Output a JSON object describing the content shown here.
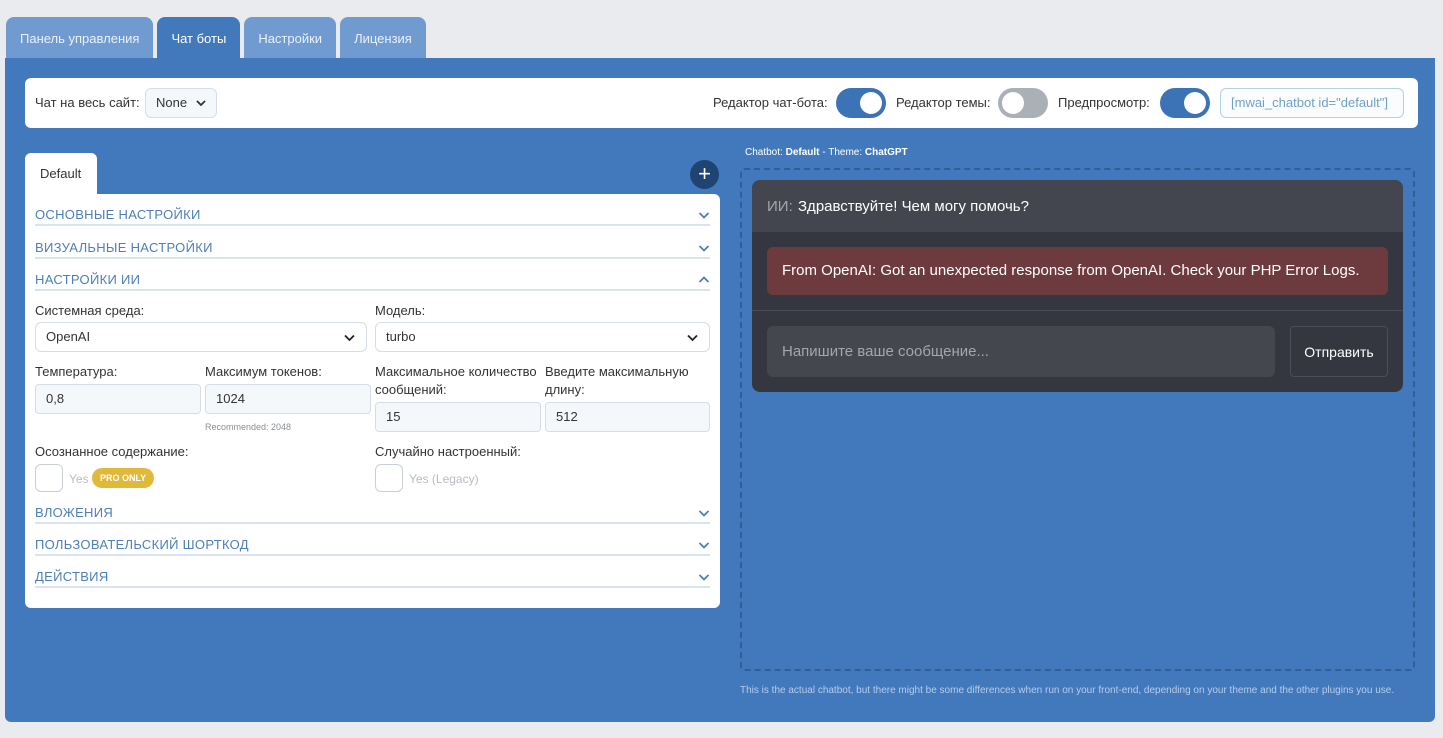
{
  "tabs": [
    "Панель управления",
    "Чат боты",
    "Настройки",
    "Лицензия"
  ],
  "active_tab": "Чат боты",
  "topbar": {
    "sitewide_label": "Чат на весь сайт:",
    "sitewide_value": "None",
    "chatbot_editor_label": "Редактор чат-бота:",
    "chatbot_editor_on": true,
    "theme_editor_label": "Редактор темы:",
    "theme_editor_on": false,
    "preview_label": "Предпросмотр:",
    "preview_on": true,
    "shortcode": "[mwai_chatbot id=\"default\"]"
  },
  "card_tab": "Default",
  "add_symbol": "+",
  "sections": {
    "basic": "ОСНОВНЫЕ НАСТРОЙКИ",
    "visual": "ВИЗУАЛЬНЫЕ НАСТРОЙКИ",
    "ai": "НАСТРОЙКИ ИИ",
    "attachments": "ВЛОЖЕНИЯ",
    "shortcode": "ПОЛЬЗОВАТЕЛЬСКИЙ ШОРТКОД",
    "actions": "ДЕЙСТВИЯ"
  },
  "ai_settings": {
    "env_label": "Системная среда:",
    "env_value": "OpenAI",
    "model_label": "Модель:",
    "model_value": "turbo",
    "temp_label": "Температура:",
    "temp_value": "0,8",
    "max_tokens_label": "Максимум токенов:",
    "max_tokens_value": "1024",
    "max_tokens_hint": "Recommended: 2048",
    "max_messages_label_1": "Максимальное количество",
    "max_messages_label_2": "сообщений:",
    "max_messages_value": "15",
    "max_length_label_1": "Введите максимальную",
    "max_length_label_2": "длину:",
    "max_length_value": "512",
    "content_aware_label": "Осознанное содержание:",
    "content_aware_yes": "Yes",
    "pro_badge": "PRO ONLY",
    "finetuned_label": "Случайно настроенный:",
    "finetuned_yes": "Yes (Legacy)"
  },
  "preview": {
    "caption_prefix": "Chatbot: ",
    "chatbot_name": "Default",
    "caption_mid": " - Theme: ",
    "theme_name": "ChatGPT",
    "ai_label": "ИИ:",
    "greeting": "Здравствуйте! Чем могу помочь?",
    "error": "From OpenAI: Got an unexpected response from OpenAI. Check your PHP Error Logs.",
    "input_placeholder": "Напишите ваше сообщение...",
    "send_label": "Отправить",
    "footnote": "This is the actual chatbot, but there might be some differences when run on your front-end, depending on your theme and the other plugins you use."
  }
}
